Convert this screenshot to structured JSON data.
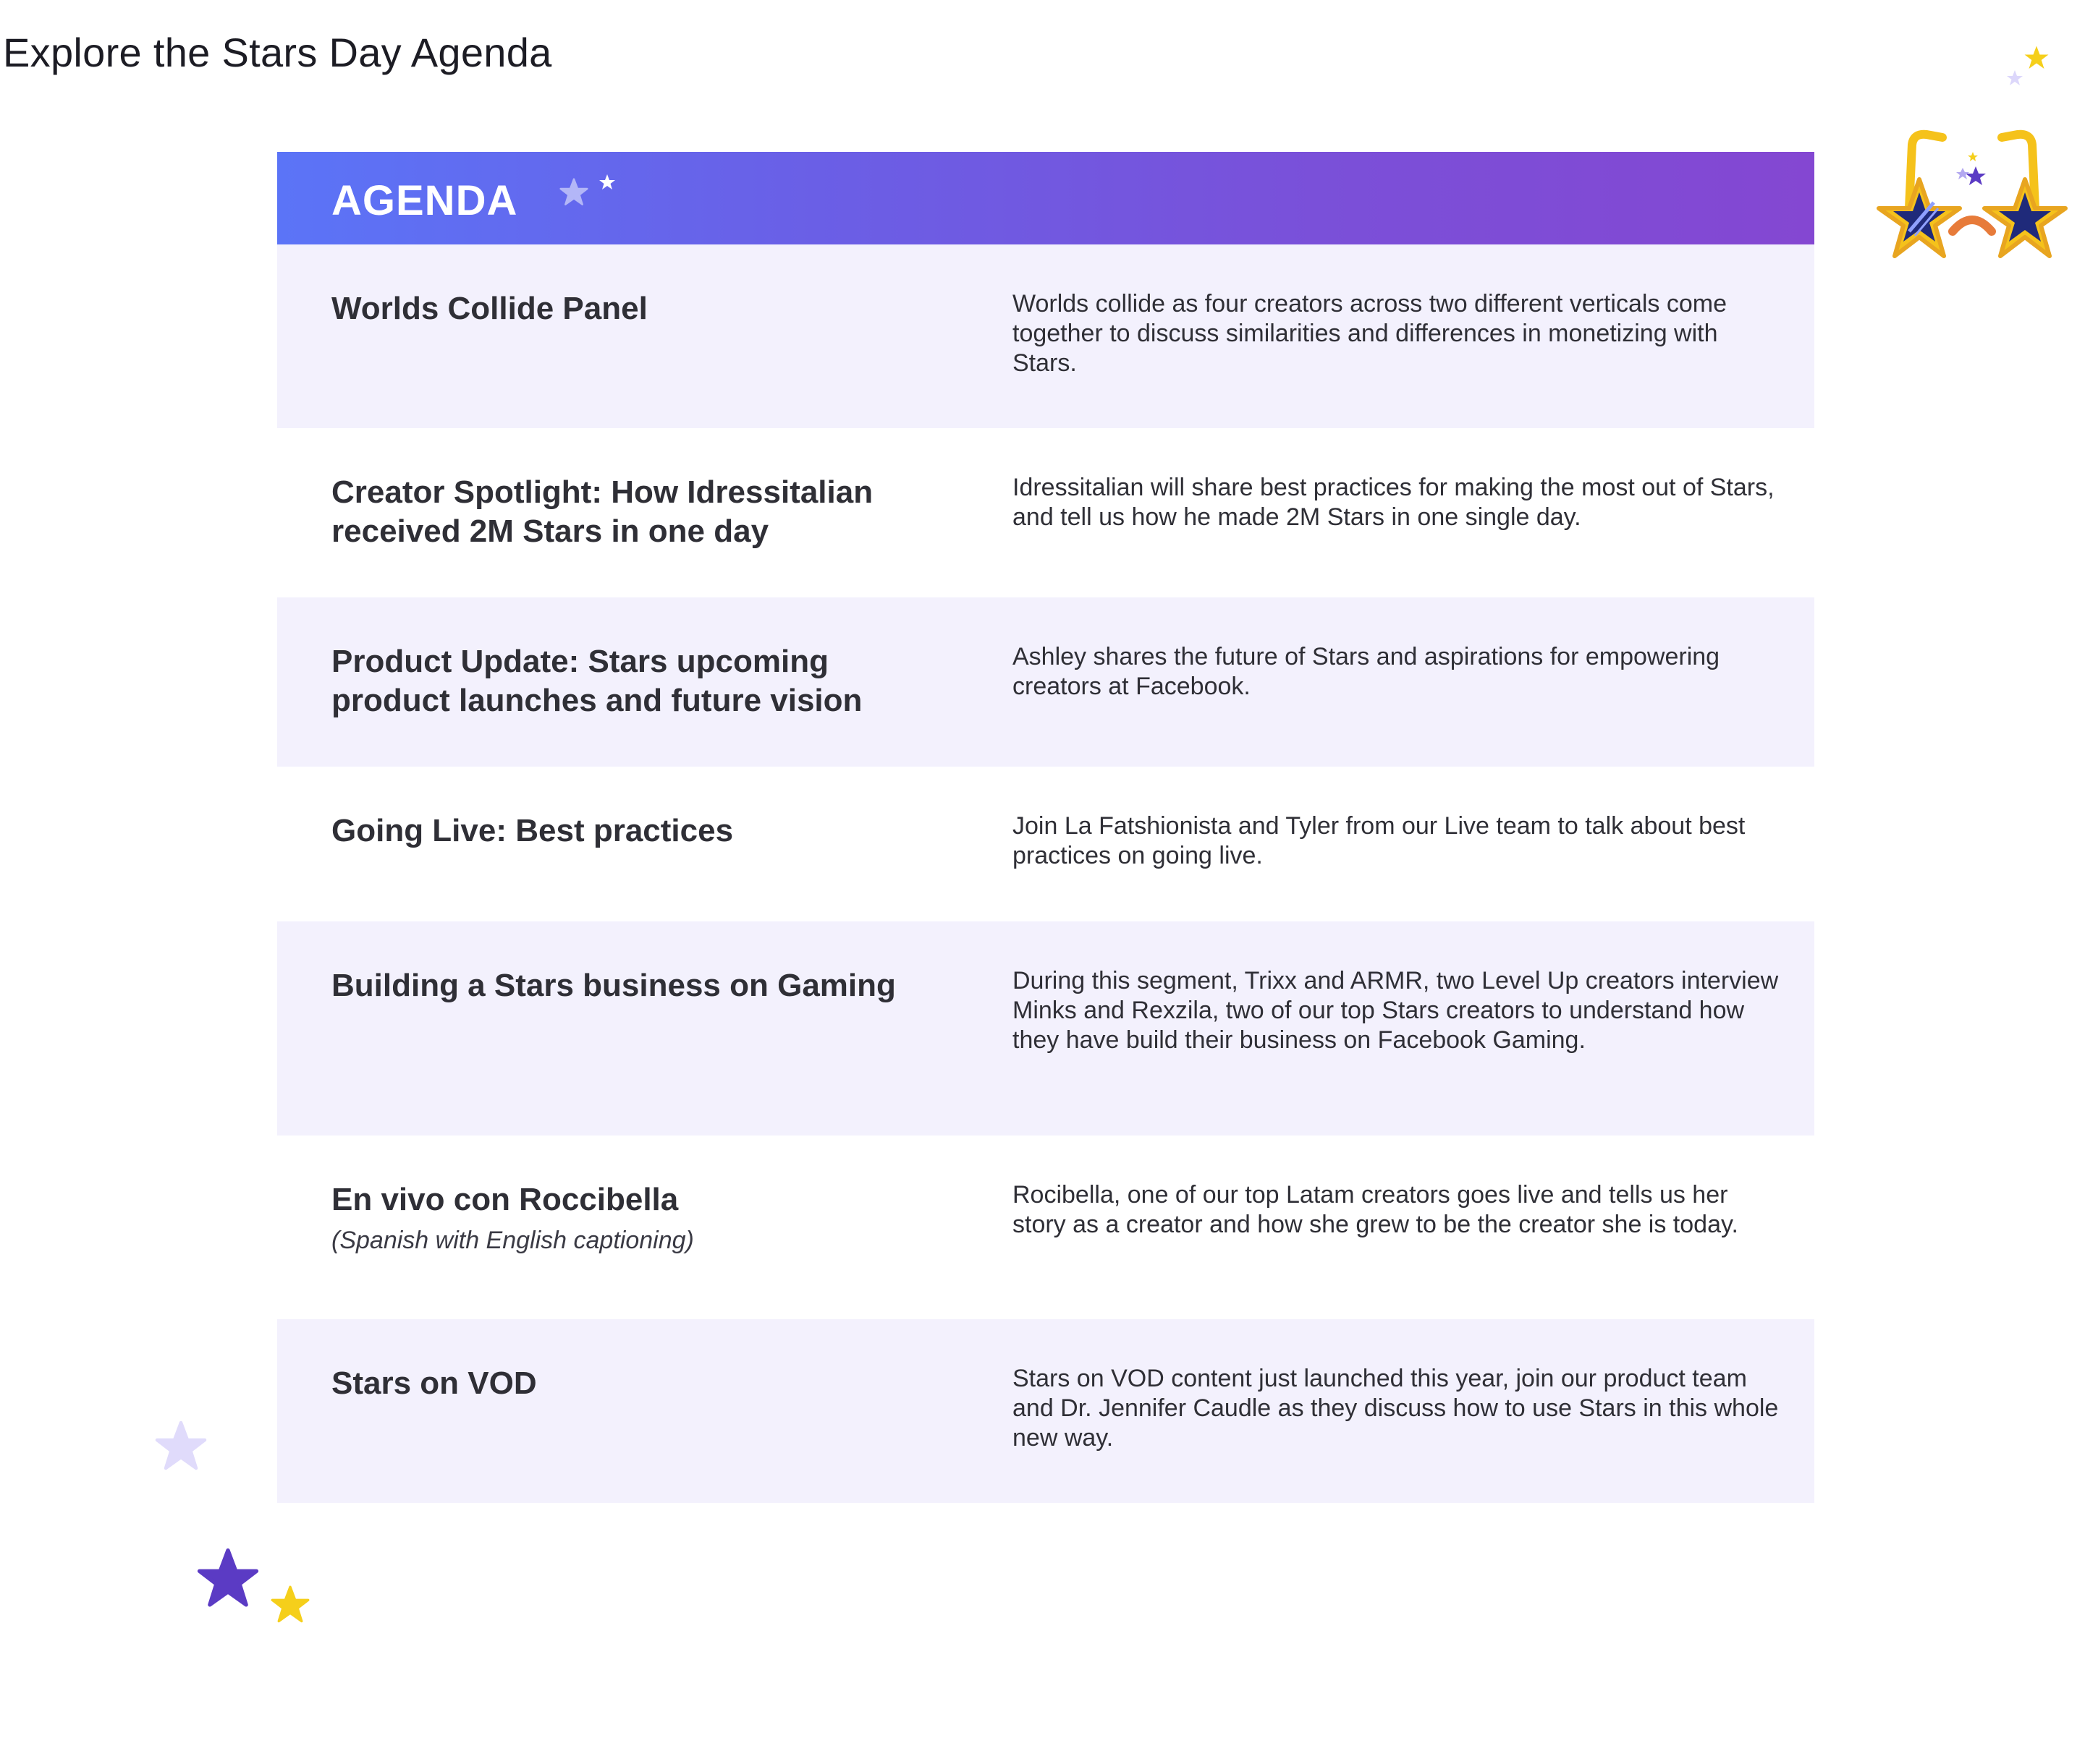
{
  "page": {
    "title": "Explore the Stars Day Agenda"
  },
  "agenda": {
    "header_label": "AGENDA",
    "items": [
      {
        "title": "Worlds Collide Panel",
        "subtitle": "",
        "description": "Worlds collide as four creators across two different verticals come together to discuss similarities and differences in monetizing with Stars."
      },
      {
        "title": "Creator Spotlight: How Idressitalian received 2M Stars in one day",
        "subtitle": "",
        "description": "Idressitalian will share best practices for making the most out of Stars, and tell us how he made 2M Stars in one single day."
      },
      {
        "title": "Product Update: Stars upcoming product launches and future vision",
        "subtitle": "",
        "description": "Ashley shares the future of Stars and aspirations for empowering creators at Facebook."
      },
      {
        "title": "Going Live: Best practices",
        "subtitle": "",
        "description": "Join La Fatshionista and Tyler from our Live team to talk about best practices on going live."
      },
      {
        "title": "Building a Stars business on Gaming",
        "subtitle": "",
        "description": "During this segment, Trixx and ARMR, two Level Up creators interview Minks and Rexzila, two of our top Stars creators to understand how they have build their business on Facebook Gaming."
      },
      {
        "title": "En vivo con Roccibella",
        "subtitle": "(Spanish with English captioning)",
        "description": "Rocibella, one of our top Latam creators goes live and tells us her story as a creator and how she grew to be the creator she is today."
      },
      {
        "title": "Stars on VOD",
        "subtitle": "",
        "description": "Stars on VOD content just launched this year, join our product team and Dr. Jennifer Caudle as they discuss how to use Stars in this whole new way."
      }
    ]
  },
  "colors": {
    "header_gradient_start": "#5b74f7",
    "header_gradient_end": "#8447d2",
    "row_shade": "#f3f1fd",
    "star_purple": "#5b3bc4",
    "star_yellow": "#f5cf1b",
    "star_lavender": "#d8d2fb"
  },
  "icons": [
    "star-icon",
    "star-glasses-icon"
  ]
}
